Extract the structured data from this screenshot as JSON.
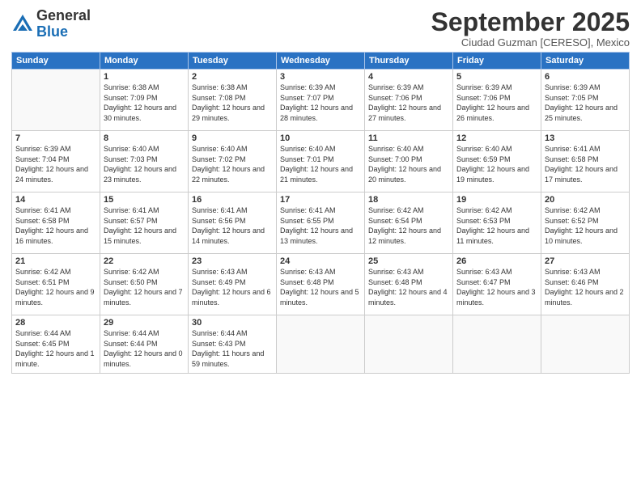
{
  "header": {
    "logo_line1": "General",
    "logo_line2": "Blue",
    "month_title": "September 2025",
    "subtitle": "Ciudad Guzman [CERESO], Mexico"
  },
  "days_of_week": [
    "Sunday",
    "Monday",
    "Tuesday",
    "Wednesday",
    "Thursday",
    "Friday",
    "Saturday"
  ],
  "weeks": [
    [
      {
        "num": "",
        "sunrise": "",
        "sunset": "",
        "daylight": ""
      },
      {
        "num": "1",
        "sunrise": "Sunrise: 6:38 AM",
        "sunset": "Sunset: 7:09 PM",
        "daylight": "Daylight: 12 hours and 30 minutes."
      },
      {
        "num": "2",
        "sunrise": "Sunrise: 6:38 AM",
        "sunset": "Sunset: 7:08 PM",
        "daylight": "Daylight: 12 hours and 29 minutes."
      },
      {
        "num": "3",
        "sunrise": "Sunrise: 6:39 AM",
        "sunset": "Sunset: 7:07 PM",
        "daylight": "Daylight: 12 hours and 28 minutes."
      },
      {
        "num": "4",
        "sunrise": "Sunrise: 6:39 AM",
        "sunset": "Sunset: 7:06 PM",
        "daylight": "Daylight: 12 hours and 27 minutes."
      },
      {
        "num": "5",
        "sunrise": "Sunrise: 6:39 AM",
        "sunset": "Sunset: 7:06 PM",
        "daylight": "Daylight: 12 hours and 26 minutes."
      },
      {
        "num": "6",
        "sunrise": "Sunrise: 6:39 AM",
        "sunset": "Sunset: 7:05 PM",
        "daylight": "Daylight: 12 hours and 25 minutes."
      }
    ],
    [
      {
        "num": "7",
        "sunrise": "Sunrise: 6:39 AM",
        "sunset": "Sunset: 7:04 PM",
        "daylight": "Daylight: 12 hours and 24 minutes."
      },
      {
        "num": "8",
        "sunrise": "Sunrise: 6:40 AM",
        "sunset": "Sunset: 7:03 PM",
        "daylight": "Daylight: 12 hours and 23 minutes."
      },
      {
        "num": "9",
        "sunrise": "Sunrise: 6:40 AM",
        "sunset": "Sunset: 7:02 PM",
        "daylight": "Daylight: 12 hours and 22 minutes."
      },
      {
        "num": "10",
        "sunrise": "Sunrise: 6:40 AM",
        "sunset": "Sunset: 7:01 PM",
        "daylight": "Daylight: 12 hours and 21 minutes."
      },
      {
        "num": "11",
        "sunrise": "Sunrise: 6:40 AM",
        "sunset": "Sunset: 7:00 PM",
        "daylight": "Daylight: 12 hours and 20 minutes."
      },
      {
        "num": "12",
        "sunrise": "Sunrise: 6:40 AM",
        "sunset": "Sunset: 6:59 PM",
        "daylight": "Daylight: 12 hours and 19 minutes."
      },
      {
        "num": "13",
        "sunrise": "Sunrise: 6:41 AM",
        "sunset": "Sunset: 6:58 PM",
        "daylight": "Daylight: 12 hours and 17 minutes."
      }
    ],
    [
      {
        "num": "14",
        "sunrise": "Sunrise: 6:41 AM",
        "sunset": "Sunset: 6:58 PM",
        "daylight": "Daylight: 12 hours and 16 minutes."
      },
      {
        "num": "15",
        "sunrise": "Sunrise: 6:41 AM",
        "sunset": "Sunset: 6:57 PM",
        "daylight": "Daylight: 12 hours and 15 minutes."
      },
      {
        "num": "16",
        "sunrise": "Sunrise: 6:41 AM",
        "sunset": "Sunset: 6:56 PM",
        "daylight": "Daylight: 12 hours and 14 minutes."
      },
      {
        "num": "17",
        "sunrise": "Sunrise: 6:41 AM",
        "sunset": "Sunset: 6:55 PM",
        "daylight": "Daylight: 12 hours and 13 minutes."
      },
      {
        "num": "18",
        "sunrise": "Sunrise: 6:42 AM",
        "sunset": "Sunset: 6:54 PM",
        "daylight": "Daylight: 12 hours and 12 minutes."
      },
      {
        "num": "19",
        "sunrise": "Sunrise: 6:42 AM",
        "sunset": "Sunset: 6:53 PM",
        "daylight": "Daylight: 12 hours and 11 minutes."
      },
      {
        "num": "20",
        "sunrise": "Sunrise: 6:42 AM",
        "sunset": "Sunset: 6:52 PM",
        "daylight": "Daylight: 12 hours and 10 minutes."
      }
    ],
    [
      {
        "num": "21",
        "sunrise": "Sunrise: 6:42 AM",
        "sunset": "Sunset: 6:51 PM",
        "daylight": "Daylight: 12 hours and 9 minutes."
      },
      {
        "num": "22",
        "sunrise": "Sunrise: 6:42 AM",
        "sunset": "Sunset: 6:50 PM",
        "daylight": "Daylight: 12 hours and 7 minutes."
      },
      {
        "num": "23",
        "sunrise": "Sunrise: 6:43 AM",
        "sunset": "Sunset: 6:49 PM",
        "daylight": "Daylight: 12 hours and 6 minutes."
      },
      {
        "num": "24",
        "sunrise": "Sunrise: 6:43 AM",
        "sunset": "Sunset: 6:48 PM",
        "daylight": "Daylight: 12 hours and 5 minutes."
      },
      {
        "num": "25",
        "sunrise": "Sunrise: 6:43 AM",
        "sunset": "Sunset: 6:48 PM",
        "daylight": "Daylight: 12 hours and 4 minutes."
      },
      {
        "num": "26",
        "sunrise": "Sunrise: 6:43 AM",
        "sunset": "Sunset: 6:47 PM",
        "daylight": "Daylight: 12 hours and 3 minutes."
      },
      {
        "num": "27",
        "sunrise": "Sunrise: 6:43 AM",
        "sunset": "Sunset: 6:46 PM",
        "daylight": "Daylight: 12 hours and 2 minutes."
      }
    ],
    [
      {
        "num": "28",
        "sunrise": "Sunrise: 6:44 AM",
        "sunset": "Sunset: 6:45 PM",
        "daylight": "Daylight: 12 hours and 1 minute."
      },
      {
        "num": "29",
        "sunrise": "Sunrise: 6:44 AM",
        "sunset": "Sunset: 6:44 PM",
        "daylight": "Daylight: 12 hours and 0 minutes."
      },
      {
        "num": "30",
        "sunrise": "Sunrise: 6:44 AM",
        "sunset": "Sunset: 6:43 PM",
        "daylight": "Daylight: 11 hours and 59 minutes."
      },
      {
        "num": "",
        "sunrise": "",
        "sunset": "",
        "daylight": ""
      },
      {
        "num": "",
        "sunrise": "",
        "sunset": "",
        "daylight": ""
      },
      {
        "num": "",
        "sunrise": "",
        "sunset": "",
        "daylight": ""
      },
      {
        "num": "",
        "sunrise": "",
        "sunset": "",
        "daylight": ""
      }
    ]
  ]
}
